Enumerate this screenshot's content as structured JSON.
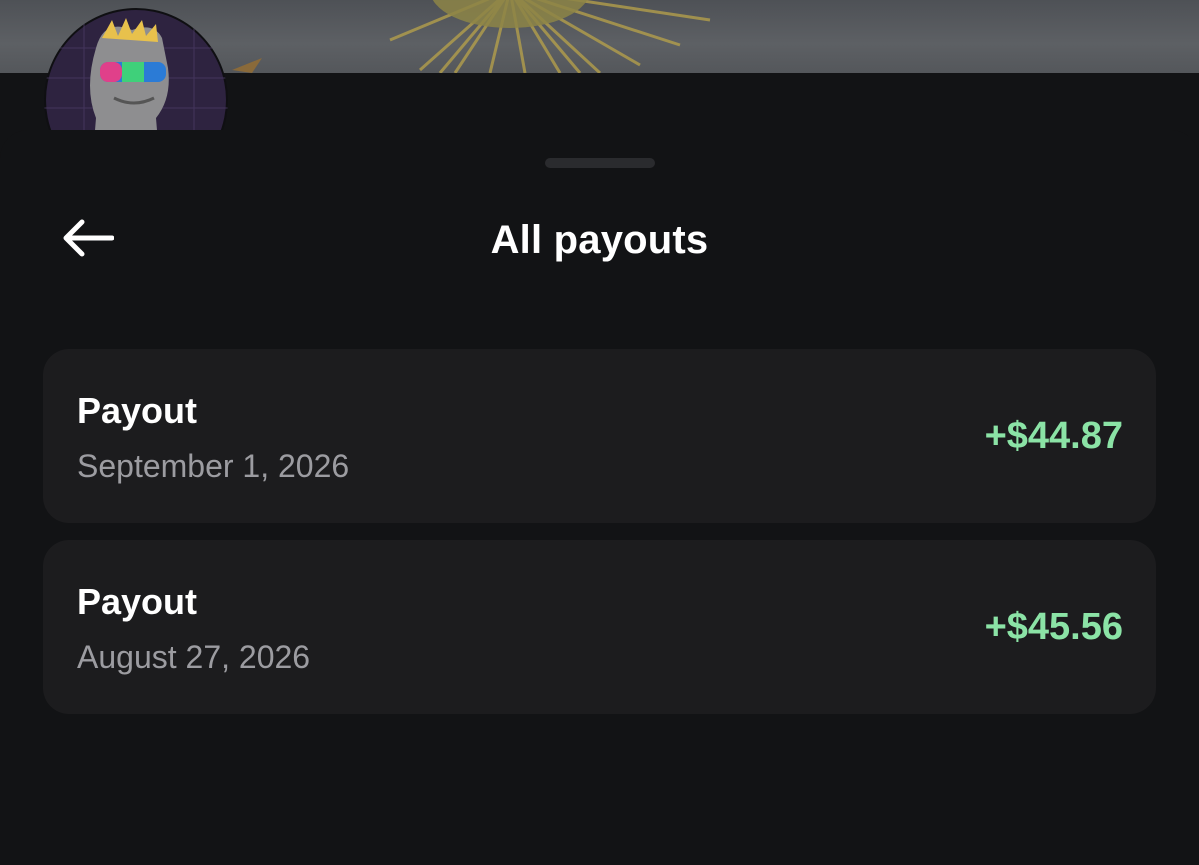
{
  "header": {
    "title": "All payouts",
    "back_icon": "arrow-left-icon"
  },
  "colors": {
    "background": "#121315",
    "card": "#1c1c1e",
    "amount_positive": "#8be3a6",
    "secondary_text": "#9c9ca1"
  },
  "payouts": [
    {
      "label": "Payout",
      "date": "September 1, 2026",
      "amount": "+$44.87"
    },
    {
      "label": "Payout",
      "date": "August 27, 2026",
      "amount": "+$45.56"
    }
  ]
}
